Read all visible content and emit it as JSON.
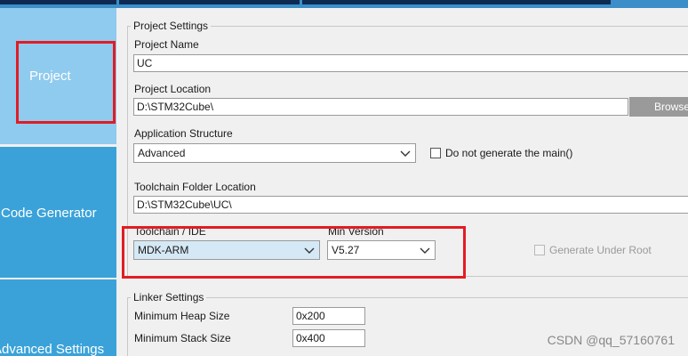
{
  "colors": {
    "nav_active": "#8fcbee",
    "nav_inactive": "#3aa2d9",
    "highlight_red": "#e21c24",
    "top_dark": "#0e2a52"
  },
  "nav": {
    "tabs": [
      {
        "label": "Project",
        "selected": true
      },
      {
        "label": "Code Generator",
        "selected": false
      },
      {
        "label": "Advanced Settings",
        "selected": false
      }
    ]
  },
  "project_settings": {
    "legend": "Project Settings",
    "project_name": {
      "label": "Project Name",
      "value": "UC"
    },
    "project_location": {
      "label": "Project Location",
      "value": "D:\\STM32Cube\\",
      "browse_label": "Browse"
    },
    "application_structure": {
      "label": "Application Structure",
      "value": "Advanced"
    },
    "no_main": {
      "label": "Do not generate the main()",
      "checked": false
    },
    "toolchain_folder": {
      "label": "Toolchain Folder Location",
      "value": "D:\\STM32Cube\\UC\\"
    },
    "toolchain_ide": {
      "label": "Toolchain / IDE",
      "value": "MDK-ARM"
    },
    "min_version": {
      "label": "Min Version",
      "value": "V5.27"
    },
    "generate_under_root": {
      "label": "Generate Under Root",
      "checked": false,
      "enabled": false
    }
  },
  "linker_settings": {
    "legend": "Linker Settings",
    "min_heap": {
      "label": "Minimum Heap Size",
      "value": "0x200"
    },
    "min_stack": {
      "label": "Minimum Stack Size",
      "value": "0x400"
    }
  },
  "watermark": "CSDN @qq_57160761"
}
